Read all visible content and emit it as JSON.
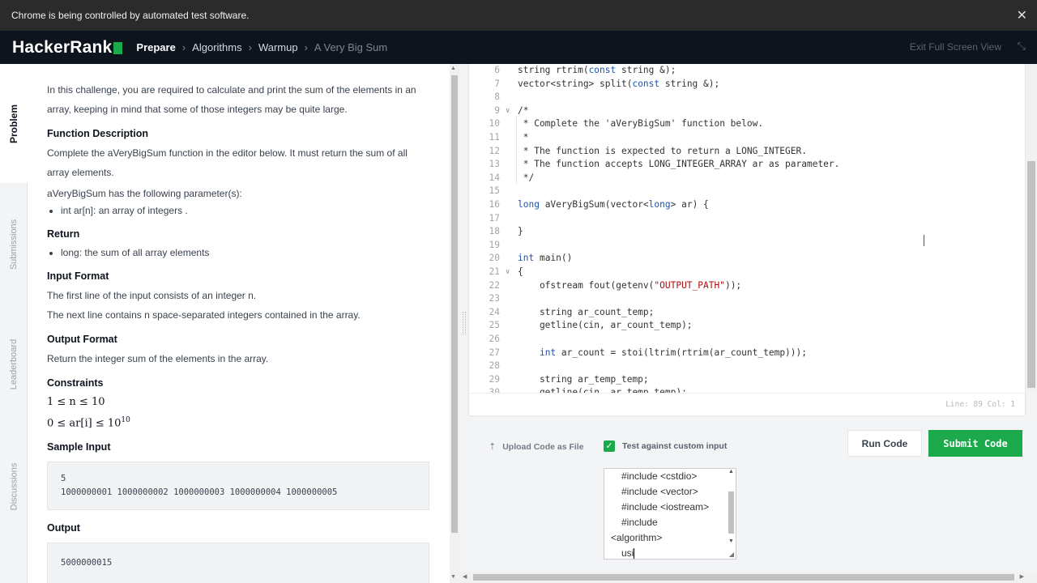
{
  "infobar": {
    "message": "Chrome is being controlled by automated test software.",
    "close": "✕"
  },
  "header": {
    "logo": "HackerRank",
    "breadcrumbs": [
      "Prepare",
      "Algorithms",
      "Warmup",
      "A Very Big Sum"
    ],
    "exit_fullscreen": "Exit Full Screen View",
    "fullscreen_icon": "⤡"
  },
  "sidetabs": [
    "Problem",
    "Submissions",
    "Leaderboard",
    "Discussions"
  ],
  "problem": {
    "intro": "In this challenge, you are required to calculate and print the sum of the elements in an array, keeping in mind that some of those integers may be quite large.",
    "function_description_heading": "Function Description",
    "function_description": "Complete the aVeryBigSum function in the editor below. It must return the sum of all array elements.",
    "params_intro": "aVeryBigSum has the following parameter(s):",
    "params": [
      "int ar[n]: an array of integers ."
    ],
    "return_heading": "Return",
    "returns": [
      "long: the sum of all array elements"
    ],
    "input_format_heading": "Input Format",
    "input_line1": "The first line of the input consists of an integer n.",
    "input_line2": "The next line contains n space-separated integers contained in the array.",
    "output_format_heading": "Output Format",
    "output_format": "Return the integer sum of the elements in the array.",
    "constraints_heading": "Constraints",
    "constraint1": "1 ≤ n ≤ 10",
    "constraint2_base": "0 ≤ ar[i] ≤ 10",
    "constraint2_exp": "10",
    "sample_input_heading": "Sample Input",
    "sample_input_lines": [
      "5",
      "1000000001 1000000002 1000000003 1000000004 1000000005"
    ],
    "output_heading": "Output",
    "sample_output": "5000000015"
  },
  "editor": {
    "lines": [
      {
        "n": "6",
        "parts": [
          [
            "",
            "string rtrim("
          ],
          [
            "kw",
            "const"
          ],
          [
            "",
            " string &);"
          ]
        ]
      },
      {
        "n": "7",
        "parts": [
          [
            "",
            "vector<string> split("
          ],
          [
            "kw",
            "const"
          ],
          [
            "",
            " string &);"
          ]
        ]
      },
      {
        "n": "8",
        "parts": []
      },
      {
        "n": "9",
        "fold": "∨",
        "comment": true,
        "parts": [
          [
            "c",
            "/*"
          ]
        ]
      },
      {
        "n": "10",
        "parts": [
          [
            "c",
            " * Complete the 'aVeryBigSum' function below."
          ]
        ]
      },
      {
        "n": "11",
        "parts": [
          [
            "c",
            " *"
          ]
        ]
      },
      {
        "n": "12",
        "parts": [
          [
            "c",
            " * The function is expected to return a LONG_INTEGER."
          ]
        ]
      },
      {
        "n": "13",
        "parts": [
          [
            "c",
            " * The function accepts LONG_INTEGER_ARRAY ar as parameter."
          ]
        ]
      },
      {
        "n": "14",
        "parts": [
          [
            "c",
            " */"
          ]
        ]
      },
      {
        "n": "15",
        "parts": []
      },
      {
        "n": "16",
        "parts": [
          [
            "kw",
            "long"
          ],
          [
            "",
            " aVeryBigSum(vector<"
          ],
          [
            "kw",
            "long"
          ],
          [
            "",
            "> ar) {"
          ]
        ]
      },
      {
        "n": "17",
        "parts": []
      },
      {
        "n": "18",
        "parts": [
          [
            "",
            "}"
          ]
        ]
      },
      {
        "n": "19",
        "parts": []
      },
      {
        "n": "20",
        "parts": [
          [
            "kw",
            "int"
          ],
          [
            "",
            " main()"
          ]
        ]
      },
      {
        "n": "21",
        "fold": "∨",
        "parts": [
          [
            "",
            "{"
          ]
        ]
      },
      {
        "n": "22",
        "parts": [
          [
            "",
            "    ofstream fout(getenv("
          ],
          [
            "str",
            "\"OUTPUT_PATH\""
          ],
          [
            "",
            "));"
          ]
        ]
      },
      {
        "n": "23",
        "parts": []
      },
      {
        "n": "24",
        "parts": [
          [
            "",
            "    string ar_count_temp;"
          ]
        ]
      },
      {
        "n": "25",
        "parts": [
          [
            "",
            "    getline(cin, ar_count_temp);"
          ]
        ]
      },
      {
        "n": "26",
        "parts": []
      },
      {
        "n": "27",
        "parts": [
          [
            "",
            "    "
          ],
          [
            "kw",
            "int"
          ],
          [
            "",
            " ar_count = stoi(ltrim(rtrim(ar_count_temp)));"
          ]
        ]
      },
      {
        "n": "28",
        "parts": []
      },
      {
        "n": "29",
        "parts": [
          [
            "",
            "    string ar_temp_temp;"
          ]
        ]
      },
      {
        "n": "30",
        "parts": [
          [
            "",
            "    getline(cin, ar_temp_temp);"
          ]
        ]
      }
    ],
    "status": "Line: 89 Col: 1"
  },
  "actions": {
    "upload_icon": "⇡",
    "upload_label": "Upload Code as File",
    "custom_input_check": "✓",
    "custom_input_label": "Test against custom input",
    "run_label": "Run Code",
    "submit_label": "Submit Code"
  },
  "custom_input": {
    "lines": [
      "#include <cstdio>",
      "#include <vector>",
      "#include <iostream>",
      "#include",
      "<algorithm>",
      "usi"
    ]
  }
}
